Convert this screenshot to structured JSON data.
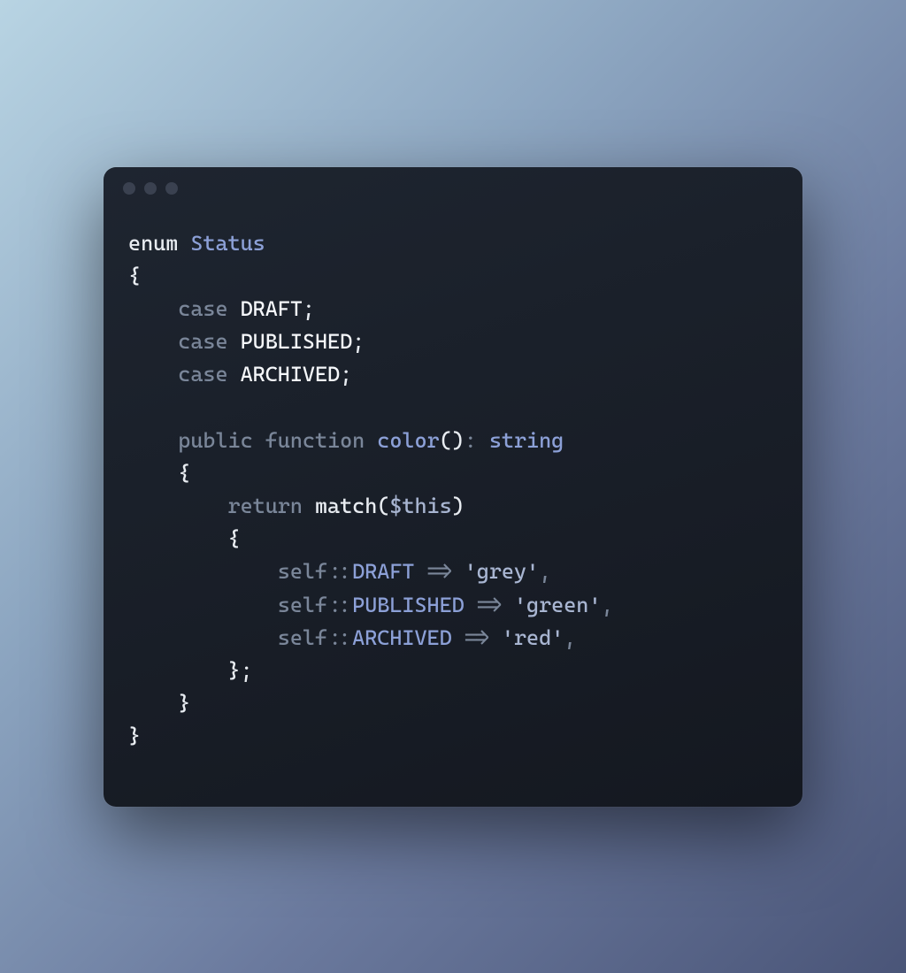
{
  "code": {
    "line1": {
      "enum": "enum",
      "name": "Status"
    },
    "braceOpen": "{",
    "cases": {
      "kw": "case",
      "c1": "DRAFT",
      "c2": "PUBLISHED",
      "c3": "ARCHIVED",
      "semi": ";"
    },
    "method": {
      "public": "public",
      "function": "function",
      "name": "color",
      "parenOpen": "(",
      "parenClose": ")",
      "colon": ":",
      "returnType": "string"
    },
    "body": {
      "return": "return",
      "match": "match",
      "parenOpen": "(",
      "thisVar": "$this",
      "parenClose": ")"
    },
    "arms": {
      "self": "self",
      "scope": "::",
      "arrow": " => ",
      "a1": {
        "const": "DRAFT",
        "value": "'grey'"
      },
      "a2": {
        "const": "PUBLISHED",
        "value": "'green'"
      },
      "a3": {
        "const": "ARCHIVED",
        "value": "'red'"
      },
      "comma": ","
    },
    "braceClose": "}",
    "braceCloseSemi": "};"
  }
}
